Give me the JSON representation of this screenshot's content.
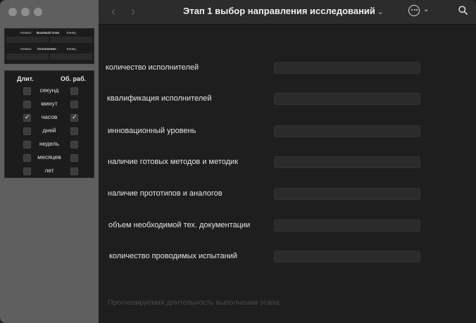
{
  "window": {
    "title": "Этап 1 выбор направления исследований"
  },
  "mini_table": {
    "row1": {
      "start": "Начало",
      "middle": "Базовый план",
      "end": "Конец"
    },
    "row2": {
      "start": "Начало",
      "middle": "Отклонение",
      "end": "Конец"
    }
  },
  "duration_panel": {
    "header_left": "Длит.",
    "header_right": "Об. раб.",
    "rows": [
      {
        "unit": "секунд",
        "dur_checked": false,
        "work_checked": false
      },
      {
        "unit": "минут",
        "dur_checked": false,
        "work_checked": false
      },
      {
        "unit": "часов",
        "dur_checked": true,
        "work_checked": true
      },
      {
        "unit": "дней",
        "dur_checked": false,
        "work_checked": false
      },
      {
        "unit": "недель",
        "dur_checked": false,
        "work_checked": false
      },
      {
        "unit": "месяцев",
        "dur_checked": false,
        "work_checked": false
      },
      {
        "unit": "лет",
        "dur_checked": false,
        "work_checked": false
      }
    ]
  },
  "form": {
    "fields": [
      {
        "label": "количество исполнителей",
        "value": ""
      },
      {
        "label": "квалификация исполнителей",
        "value": ""
      },
      {
        "label": "инновационный уровень",
        "value": ""
      },
      {
        "label": "наличие готовых методов и методик",
        "value": ""
      },
      {
        "label": "наличие прототипов и аналогов",
        "value": ""
      },
      {
        "label": "объем необходимой тех. документации",
        "value": ""
      },
      {
        "label": "количество проводимых испытаний",
        "value": ""
      }
    ],
    "forecast_label": "Прогнозируемая длительность выполнения этапа:"
  },
  "icons": {
    "back": "chevron-left-icon",
    "forward": "chevron-right-icon",
    "title_menu": "chevron-down-icon",
    "more": "ellipsis-circle-icon",
    "search": "search-icon"
  }
}
